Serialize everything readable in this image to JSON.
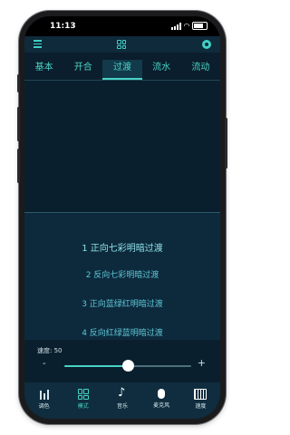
{
  "status": {
    "time": "11:13"
  },
  "tabs": [
    {
      "label": "基本"
    },
    {
      "label": "开合"
    },
    {
      "label": "过渡",
      "active": true
    },
    {
      "label": "流水"
    },
    {
      "label": "流动"
    }
  ],
  "modes": [
    {
      "label": "1 正向七彩明暗过渡",
      "selected": true
    },
    {
      "label": "2 反向七彩明暗过渡"
    },
    {
      "label": "3 正向蓝绿红明暗过渡"
    },
    {
      "label": "4 反向红绿蓝明暗过渡"
    }
  ],
  "speed": {
    "label": "速度: 50",
    "value": 50,
    "min": 0,
    "max": 100,
    "minus": "-",
    "plus": "+"
  },
  "bottom_nav": [
    {
      "label": "调色",
      "icon": "equalizer-icon"
    },
    {
      "label": "模式",
      "icon": "grid-icon",
      "active": true
    },
    {
      "label": "音乐",
      "icon": "music-note-icon"
    },
    {
      "label": "麦克风",
      "icon": "microphone-icon"
    },
    {
      "label": "速度",
      "icon": "keyboard-icon"
    }
  ],
  "colors": {
    "accent": "#49d3c6",
    "background": "#0b1e2d",
    "list_bg": "#0c2a3c",
    "nav_bg": "#0f2d3e"
  }
}
